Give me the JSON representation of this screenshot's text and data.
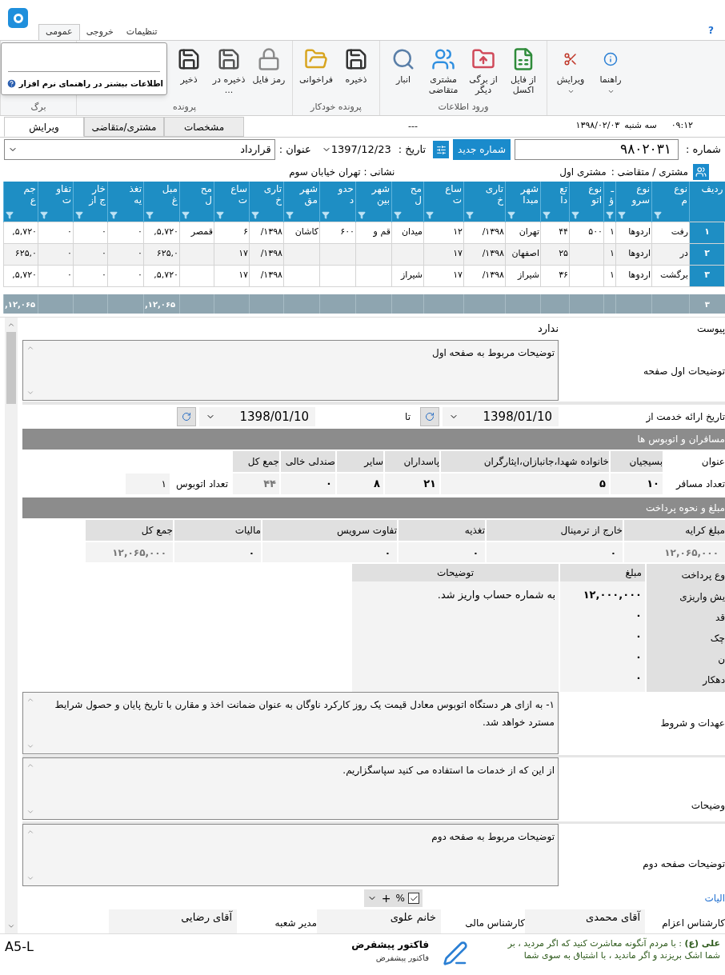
{
  "ribbon": {
    "tabs": [
      {
        "label": "تنظیمات",
        "selected": false
      },
      {
        "label": "خروجی",
        "selected": false
      },
      {
        "label": "عمومی",
        "selected": true
      }
    ],
    "help": "?",
    "groups": [
      {
        "buttons": [
          {
            "label": "راهنما",
            "kind": "info",
            "dropdown": true
          },
          {
            "label": "ویرایش",
            "kind": "cut",
            "dropdown": true
          }
        ]
      },
      {
        "label": "ورود اطلاعات",
        "buttons": [
          {
            "label": "از فایل اکسل",
            "kind": "excel",
            "dropdown": false
          },
          {
            "label": "از برگی دیگر",
            "kind": "folder",
            "dropdown": false
          },
          {
            "label": "مشتری متقاضی",
            "kind": "users",
            "dropdown": false
          },
          {
            "label": "انبار",
            "kind": "search",
            "dropdown": false
          }
        ]
      },
      {
        "label": "پرونده خودکار",
        "buttons": [
          {
            "label": "ذخیره",
            "kind": "save",
            "dropdown": false
          },
          {
            "label": "فراخوانی",
            "kind": "open",
            "dropdown": false
          }
        ]
      },
      {
        "label": "پرونده",
        "buttons": [
          {
            "label": "رمز فایل",
            "kind": "lock",
            "dropdown": false
          },
          {
            "label": "ذخیره در ...",
            "kind": "saveas",
            "dropdown": false
          },
          {
            "label": "ذخیر",
            "kind": "save",
            "dropdown": false
          }
        ]
      },
      {
        "label": "برگ"
      }
    ],
    "tooltip": "اطلاعات بیشتر در راهنمای نرم افزار"
  },
  "doc_tabs": [
    {
      "label": "مشخصات",
      "selected": false
    },
    {
      "label": "مشتری/متقاضی",
      "selected": false
    },
    {
      "label": "ویرایش",
      "selected": true
    }
  ],
  "separator_text": "---",
  "clock": {
    "date": "۱۳۹۸/۰۲/۰۳",
    "day": "سه شنبه",
    "time": "۰۹:۱۲"
  },
  "header": {
    "number_label": "شماره :",
    "number": "۹۸۰۲۰۳۱",
    "new_number": "شماره جدید",
    "date_label": "تاریخ :",
    "date": "1397/12/23",
    "title_label": "عنوان :",
    "title": "قرارداد"
  },
  "customer": {
    "label": "مشتری / متقاضی :",
    "name": "مشتری اول",
    "address": "نشانی : تهران خیابان سوم"
  },
  "table": {
    "columns": [
      "ردیف",
      "نوع\nم",
      "نوع\nسرو",
      "ـ\nؤ",
      "نوع\nاتو",
      "تع\nدا",
      "شهر\nمبدا",
      "تاری\nخ",
      "ساع\nت",
      "مح\nل",
      "شهر\nبین",
      "حدو\nد",
      "شهر\nمق",
      "تاری\nخ",
      "ساع\nت",
      "مح\nل",
      "مبل\nغ",
      "تغذ\nیه",
      "خار\nج از",
      "تفاو\nت",
      "جم\nع"
    ],
    "rows": [
      {
        "cells": [
          "۱",
          "رفت",
          "اردوها",
          "۱",
          "۵۰۰",
          "۴۴",
          "تهران",
          "۱۳۹۸/",
          "۱۲",
          "میدان",
          "قم و",
          "۶۰۰",
          "کاشان",
          "۱۳۹۸/",
          "۶",
          "قمصر",
          "۵,۷۲۰,",
          "۰",
          "۰",
          "۰",
          "۵,۷۲۰,"
        ]
      },
      {
        "cells": [
          "۲",
          "در",
          "اردوها",
          "۱",
          null,
          "۲۵",
          "اصفهان",
          "۱۳۹۸/",
          "۱۷",
          null,
          null,
          null,
          null,
          "۱۳۹۸/",
          "۱۷",
          null,
          "۶۲۵,۰",
          "۰",
          "۰",
          "۰",
          "۶۲۵,۰"
        ]
      },
      {
        "cells": [
          "۳",
          "برگشت",
          "اردوها",
          "۱",
          null,
          "۳۶",
          "شیراز",
          "۱۳۹۸/",
          "۱۷",
          "شیراز",
          null,
          null,
          null,
          "۱۳۹۸/",
          "۱۷",
          null,
          "۵,۷۲۰,",
          "۰",
          "۰",
          "۰",
          "۵,۷۲۰,"
        ]
      }
    ],
    "footer": {
      "count": "۳",
      "amount": "۱۲,۰۶۵,",
      "total": "۱۲,۰۶۵,"
    }
  },
  "attachment": {
    "label": "پیوست",
    "value": "ندارد"
  },
  "first_page_notes": {
    "label": "توضیحات اول صفحه",
    "value": "توضیحات مربوط به صفحه اول"
  },
  "service_dates": {
    "label": "تاریخ ارائه خدمت از",
    "from": "1398/01/10",
    "to_label": "تا",
    "to": "1398/01/10"
  },
  "passengers": {
    "title": "مسافران و اتوبوس ها",
    "headers": [
      "عنوان",
      "بسیجیان",
      "خانواده شهدا،جانبازان،ایثارگران",
      "پاسداران",
      "سایر",
      "صندلی خالی",
      "جمع کل"
    ],
    "row_label": "تعداد مسافر",
    "values": [
      "۱۰",
      "۵",
      "۲۱",
      "۸",
      "۰",
      "۴۴"
    ],
    "bus_label": "تعداد اتوبوس",
    "bus_count": "۱"
  },
  "payment": {
    "title": "مبلغ و نحوه پرداخت",
    "headers": [
      "مبلغ کرایه",
      "خارج از ترمینال",
      "تغذیه",
      "تفاوت سرویس",
      "مالیات",
      "جمع کل"
    ],
    "values": [
      "۱۲,۰۶۵,۰۰۰",
      "۰",
      "۰",
      "۰",
      "۰",
      "۱۲,۰۶۵,۰۰۰"
    ],
    "methods_header": [
      "وع پرداخت",
      "مبلغ",
      "توضیحات"
    ],
    "methods": [
      {
        "type": "یش واریزی",
        "amount": "۱۲,۰۰۰,۰۰۰",
        "note": "به شماره حساب واریز شد."
      },
      {
        "type": "قد",
        "amount": "۰"
      },
      {
        "type": "چک",
        "amount": "۰"
      },
      {
        "type": "ن",
        "amount": "۰"
      },
      {
        "type": "دهکار",
        "amount": "۰"
      }
    ]
  },
  "terms": {
    "label": "عهدات و شروط",
    "value": "۱- به ازای هر دستگاه اتوبوس معادل قیمت یک روز کارکرد ناوگان به عنوان ضمانت اخذ و مقارن با تاریخ پایان و حصول شرایط مسترد خواهد شد."
  },
  "notes": {
    "label": "وضیحات",
    "value": "از این که از خدمات ما استفاده می کنید سپاسگزاریم."
  },
  "second_page_notes": {
    "label": "توضیحات صفحه دوم",
    "value": "توضیحات مربوط به صفحه دوم"
  },
  "tax": {
    "label": "الیات",
    "percent_checked": true,
    "percent": "%",
    "plus": "+"
  },
  "signatures": [
    {
      "role": "کارشناس اعزام",
      "name": "آقای محمدی"
    },
    {
      "role": "کارشناس مالی",
      "name": "خانم علوی"
    },
    {
      "role": "مدیر شعبه",
      "name": "آقای رضایی"
    }
  ],
  "status": {
    "quote": "**علی (ع)** : با مردم آنگونه معاشرت کنید که اگر مردید ، بر\nشما اشک بریزند و اگر ماندید ، با اشتیاق به سوی شما",
    "template": "فاکتور پیشفرض",
    "template_sub": "فاکتور پیشفرض",
    "page": "A5-L"
  }
}
